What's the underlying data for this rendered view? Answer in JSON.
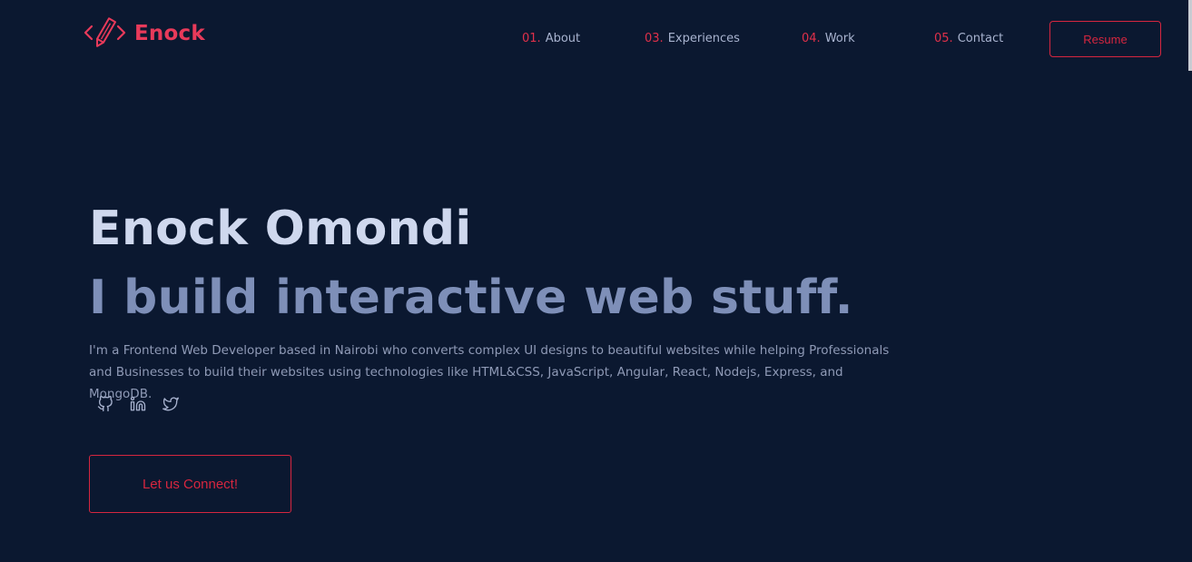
{
  "brand": {
    "name": "Enock",
    "logo_icon": "code-pencil-icon",
    "accent": "#e83a5a"
  },
  "nav": {
    "items": [
      {
        "num": "01.",
        "label": "About"
      },
      {
        "num": "03.",
        "label": "Experiences"
      },
      {
        "num": "04.",
        "label": "Work"
      },
      {
        "num": "05.",
        "label": "Contact"
      }
    ],
    "resume_label": "Resume"
  },
  "hero": {
    "name": "Enock Omondi",
    "tagline": "I build interactive web stuff.",
    "description": "I'm a Frontend Web Developer based in Nairobi who converts complex UI designs to beautiful websites while helping Professionals and Businesses to build their websites using technologies like HTML&CSS, JavaScript, Angular, React, Nodejs, Express, and MongoDB.",
    "socials": [
      {
        "icon": "github-icon"
      },
      {
        "icon": "linkedin-icon"
      },
      {
        "icon": "twitter-icon"
      }
    ],
    "cta_label": "Let us Connect!"
  },
  "colors": {
    "background": "#0b1830",
    "accent": "#d6263f",
    "heading": "#cfd8ee",
    "subheading": "#7e8fb8",
    "text": "#8f9ab6"
  }
}
